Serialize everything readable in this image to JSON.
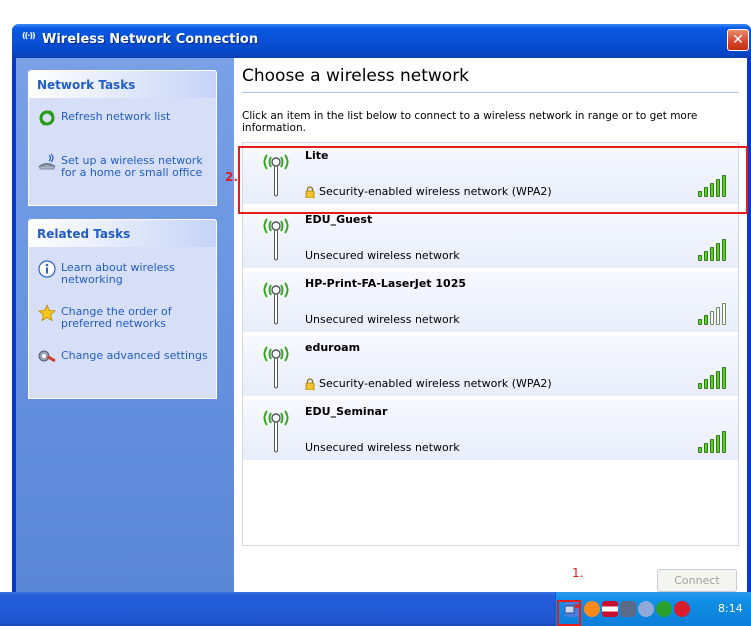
{
  "window": {
    "title": "Wireless Network Connection",
    "title_icon": "((·))",
    "close_glyph": "✕"
  },
  "network_tasks": {
    "header": "Network Tasks",
    "items": [
      {
        "label": "Refresh network list",
        "icon": "refresh-icon"
      },
      {
        "label": "Set up a wireless network for a home or small office",
        "icon": "setup-wireless-icon"
      }
    ]
  },
  "related_tasks": {
    "header": "Related Tasks",
    "items": [
      {
        "label": "Learn about wireless networking",
        "icon": "info-icon"
      },
      {
        "label": "Change the order of preferred networks",
        "icon": "star-icon"
      },
      {
        "label": "Change advanced settings",
        "icon": "settings-icon"
      }
    ]
  },
  "main": {
    "heading": "Choose a wireless network",
    "instructions": "Click an item in the list below to connect to a wireless network in range or to get more information.",
    "connect_label": "Connect"
  },
  "networks": [
    {
      "ssid": "Lite",
      "security": "Security-enabled wireless network (WPA2)",
      "secured": true,
      "signal_bars": 5
    },
    {
      "ssid": "EDU_Guest",
      "security": "Unsecured wireless network",
      "secured": false,
      "signal_bars": 5
    },
    {
      "ssid": "HP-Print-FA-LaserJet 1025",
      "security": "Unsecured wireless network",
      "secured": false,
      "signal_bars": 2
    },
    {
      "ssid": "eduroam",
      "security": "Security-enabled wireless network (WPA2)",
      "secured": true,
      "signal_bars": 5
    },
    {
      "ssid": "EDU_Seminar",
      "security": "Unsecured wireless network",
      "secured": false,
      "signal_bars": 5
    }
  ],
  "annotations": {
    "step1": "1.",
    "step2": "2."
  },
  "taskbar": {
    "clock": "8:14",
    "tray_icons": [
      "wireless-tray-icon",
      "avast-tray-icon",
      "flag-tray-icon",
      "network-tray-icon",
      "sound-tray-icon",
      "update-tray-icon",
      "security-tray-icon"
    ]
  },
  "colors": {
    "title_blue": "#0a5ae4",
    "link_blue": "#215dc6",
    "signal_green": "#62cd2a",
    "annotation_red": "#e31c1c"
  }
}
